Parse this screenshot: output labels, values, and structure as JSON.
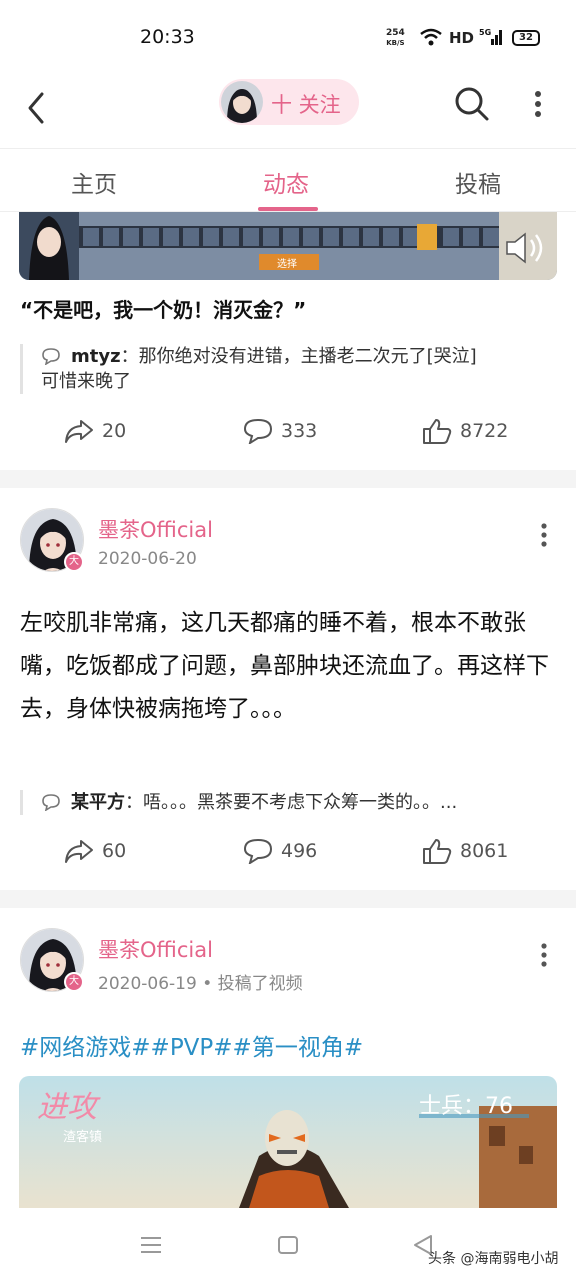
{
  "status_bar": {
    "time": "20:33",
    "net_speed": "254",
    "net_unit": "KB/S",
    "hd": "HD",
    "signal": "5G",
    "battery": "32"
  },
  "header": {
    "follow_label": "十 关注"
  },
  "tabs": [
    {
      "label": "主页"
    },
    {
      "label": "动态"
    },
    {
      "label": "投稿"
    }
  ],
  "post1": {
    "game_button": "选择",
    "quote": "“不是吧，我一个奶！消灭金？”",
    "comment_user": "mtyz",
    "comment_text": "：那你绝对没有进错，主播老二次元了[哭泣]",
    "comment_text2": "可惜来晚了",
    "shares": "20",
    "comments": "333",
    "likes": "8722"
  },
  "post2": {
    "author": "墨茶Official",
    "date": "2020-06-20",
    "text": "左咬肌非常痛，这几天都痛的睡不着，根本不敢张嘴，吃饭都成了问题，鼻部肿块还流血了。再这样下去，身体快被病拖垮了。。。",
    "comment_user": "某平方",
    "comment_text": "：唔。。。黑茶要不考虑下众筹一类的。。...",
    "shares": "60",
    "comments": "496",
    "likes": "8061"
  },
  "post3": {
    "author": "墨茶Official",
    "date": "2020-06-19 • 投稿了视频",
    "hashtags": "#网络游戏##PVP##第一视角#",
    "video_overlay_left": "进攻",
    "video_overlay_sub": "渣客镇",
    "video_overlay_right": "士兵：76"
  },
  "watermark": "头条 @海南弱电小胡",
  "colors": {
    "accent": "#e4648a",
    "hashtag": "#2a8fc5"
  }
}
